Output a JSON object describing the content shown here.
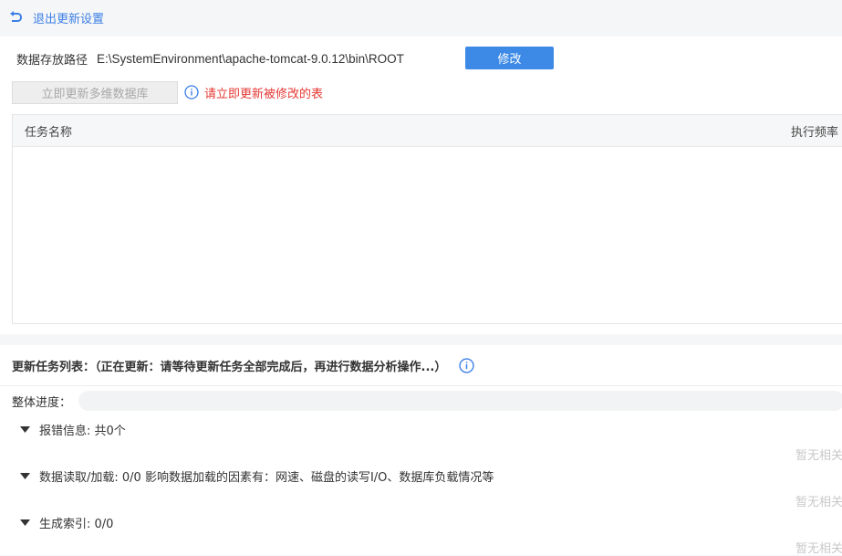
{
  "header": {
    "back_label": "退出更新设置"
  },
  "settings": {
    "path_label": "数据存放路径",
    "path_value": "E:\\SystemEnvironment\\apache-tomcat-9.0.12\\bin\\ROOT",
    "modify_label": "修改",
    "update_label": "立即更新多维数据库",
    "note": "请立即更新被修改的表"
  },
  "table": {
    "columns": [
      "任务名称",
      "执行频率"
    ]
  },
  "tasks": {
    "title": "更新任务列表：（正在更新：请等待更新任务全部完成后，再进行数据分析操作...）",
    "progress_label": "整体进度：",
    "progress_value": 0,
    "sections": [
      {
        "label": "报错信息: 共0个",
        "empty": "暂无相关"
      },
      {
        "label": "数据读取/加载: 0/0 影响数据加载的因素有：网速、磁盘的读写I/O、数据库负载情况等",
        "empty": "暂无相关"
      },
      {
        "label": "生成索引: 0/0",
        "empty": "暂无相关"
      }
    ]
  },
  "colors": {
    "accent": "#3d8ae6",
    "warning": "#e53935"
  }
}
